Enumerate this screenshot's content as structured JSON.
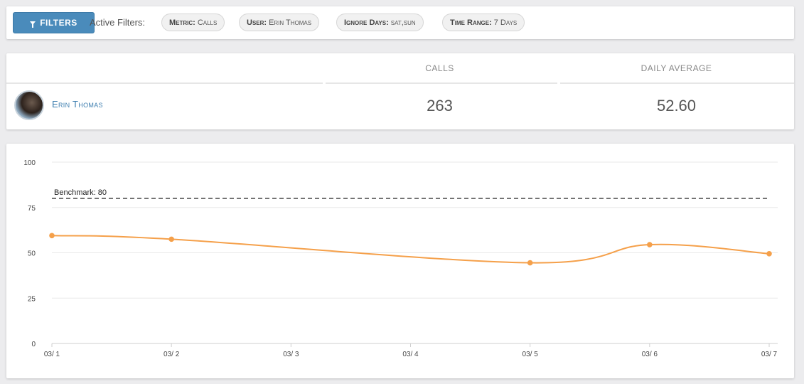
{
  "filter_bar": {
    "filters_button_label": "FILTERS",
    "active_filters_label": "Active Filters:",
    "chips": [
      {
        "key": "Metric:",
        "value": "Calls"
      },
      {
        "key": "User:",
        "value": "Erin Thomas"
      },
      {
        "key": "Ignore Days:",
        "value": "sat,sun"
      },
      {
        "key": "Time Range:",
        "value": "7 Days"
      }
    ]
  },
  "stats": {
    "headers": {
      "calls": "CALLS",
      "daily_average": "DAILY AVERAGE"
    },
    "row": {
      "user_name": "Erin Thomas",
      "calls": "263",
      "daily_average": "52.60"
    }
  },
  "colors": {
    "accent": "#4a8bbb",
    "series": "#f5a04a",
    "benchmark": "#222222"
  },
  "chart_data": {
    "type": "line",
    "categories": [
      "03/ 1",
      "03/ 2",
      "03/ 3",
      "03/ 4",
      "03/ 5",
      "03/ 6",
      "03/ 7"
    ],
    "series": [
      {
        "values": [
          59.5,
          57.5,
          null,
          null,
          44.5,
          54.5,
          49.5
        ]
      }
    ],
    "benchmark": {
      "label": "Benchmark: 80",
      "value": 80
    },
    "yticks": [
      0,
      25,
      50,
      75,
      100
    ],
    "ylim": [
      0,
      100
    ],
    "grid": true
  }
}
